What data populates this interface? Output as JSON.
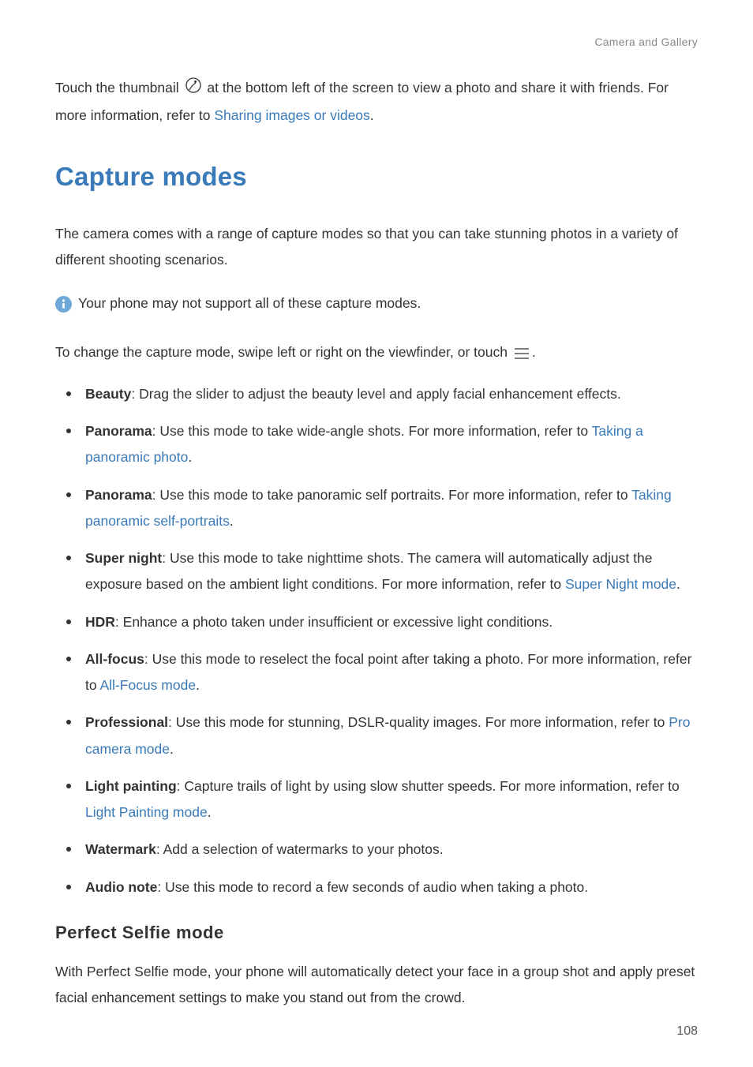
{
  "header": {
    "breadcrumb": "Camera and Gallery"
  },
  "intro": {
    "before": "Touch the thumbnail ",
    "after": " at the bottom left of the screen to view a photo and share it with friends. For more information, refer to ",
    "link": "Sharing images or videos",
    "period": "."
  },
  "h1": "Capture modes",
  "lead": "The camera comes with a range of capture modes so that you can take stunning photos in a variety of different shooting scenarios.",
  "info_note": "Your phone may not support all of these capture modes.",
  "change": {
    "before": "To change the capture mode, swipe left or right on the viewfinder, or touch ",
    "after": "."
  },
  "items": [
    {
      "label": "Beauty",
      "after_colon": ": Drag the slider to adjust the beauty level and apply facial enhancement effects."
    },
    {
      "label": "Panorama",
      "after_colon": ": Use this mode to take wide-angle shots. For more information, refer to ",
      "link": "Taking a panoramic photo",
      "tail": "."
    },
    {
      "label": "Panorama",
      "after_colon": ": Use this mode to take panoramic self portraits. For more information, refer to ",
      "link": "Taking panoramic self-portraits",
      "tail": "."
    },
    {
      "label": "Super night",
      "after_colon": ": Use this mode to take nighttime shots. The camera will automatically adjust the exposure based on the ambient light conditions. For more information, refer to ",
      "link": "Super Night mode",
      "tail": "."
    },
    {
      "label": "HDR",
      "after_colon": ": Enhance a photo taken under insufficient or excessive light conditions."
    },
    {
      "label": "All-focus",
      "after_colon": ": Use this mode to reselect the focal point after taking a photo. For more information, refer to ",
      "link": "All-Focus mode",
      "tail": "."
    },
    {
      "label": "Professional",
      "after_colon": ": Use this mode for stunning, DSLR-quality images. For more information, refer to ",
      "link": "Pro camera mode",
      "tail": "."
    },
    {
      "label": "Light painting",
      "after_colon": ": Capture trails of light by using slow shutter speeds. For more information, refer to ",
      "link": "Light Painting mode",
      "tail": "."
    },
    {
      "label": "Watermark",
      "after_colon": ": Add a selection of watermarks to your photos."
    },
    {
      "label": "Audio note",
      "after_colon": ": Use this mode to record a few seconds of audio when taking a photo."
    }
  ],
  "h2": "Perfect  Selfie  mode",
  "selfie_para": "With Perfect Selfie mode, your phone will automatically detect your face in a group shot and apply preset facial enhancement settings to make you stand out from the crowd.",
  "page_number": "108"
}
